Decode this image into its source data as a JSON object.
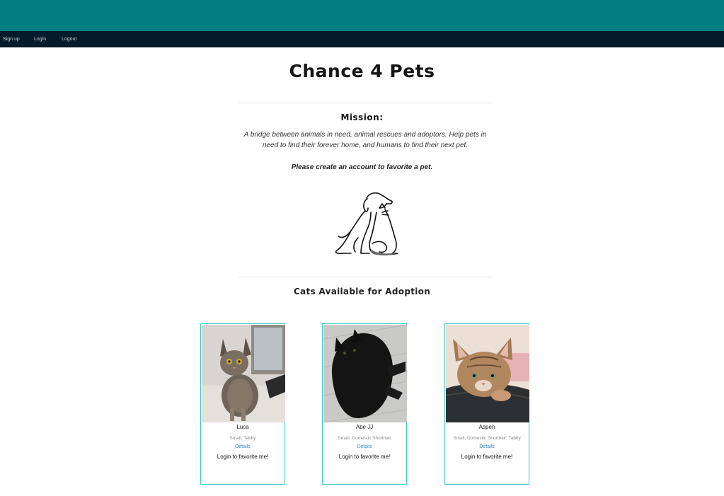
{
  "nav": {
    "signup": "Sign up",
    "login": "Login",
    "logout": "Logout"
  },
  "site_title": "Chance 4 Pets",
  "mission": {
    "heading": "Mission:",
    "text": "A bridge between animals in need, animal rescues and adoptors. Help pets in need to find their forever home, and humans to find their next pet.",
    "cta": "Please create an account to favorite a pet."
  },
  "section_title": "Cats Available for Adoption",
  "colors": {
    "topbar": "#017f80",
    "navbar": "#051a2b",
    "card_border": "#3cc8c8",
    "link": "#2e8bd6"
  },
  "cats": [
    {
      "name": "Luca",
      "desc": "Small, Tabby",
      "details": "Details",
      "favorite": "Login to favorite me!"
    },
    {
      "name": "Abe JJ",
      "desc": "Small, Domestic Shorthair",
      "details": "Details",
      "favorite": "Login to favorite me!"
    },
    {
      "name": "Aspen",
      "desc": "Small, Domestic Shorthair, Tabby",
      "details": "Details",
      "favorite": "Login to favorite me!"
    }
  ]
}
